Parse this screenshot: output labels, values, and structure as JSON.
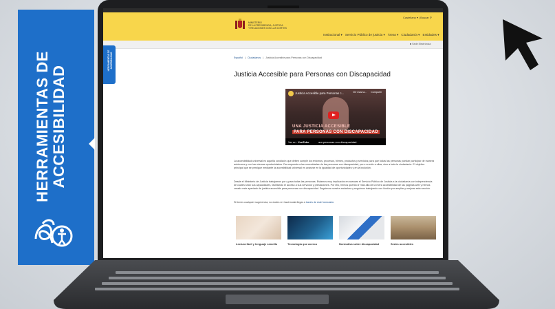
{
  "banner": {
    "line1": "HERRAMIENTAS DE",
    "line2": "ACCESIBILIDAD"
  },
  "site": {
    "gov_name": "MINISTERIO\nDE LA PRESIDENCIA, JUSTICIA\nY RELACIONES CON LAS CORTES",
    "util": "Castellano ▾  |  Buscar",
    "nav": [
      "Institucional ▾",
      "Servicio Público de justicia ▾",
      "Áreas ▾",
      "Ciudadanía ▾",
      "Entidades ▾"
    ],
    "sede": "Sede Electrónica",
    "side_tab": "HERRAMIENTAS DE ACCESIBILIDAD",
    "breadcrumb": [
      "Español",
      "Ciudadanos",
      "Justicia Accesible para Personas con Discapacidad"
    ],
    "title": "Justicia Accesible para Personas con Discapacidad",
    "video": {
      "title": "Justicia Accesible para Personas c...",
      "watch_later": "Ver más ta...",
      "share": "Compartir",
      "line1": "UNA JUSTICIA ACCESIBLE",
      "line2": "PARA PERSONAS CON DISCAPACIDAD",
      "watch_on": "Ver en",
      "youtube": "YouTube",
      "caption": "ara personas con discapacidad."
    },
    "para1": "La accesibilidad universal es aquella condición que deben cumplir los entornos, procesos, bienes, productos y servicios para que todas las personas puedan participar de manera autónoma y con las mismas oportunidades. Da respuesta a las necesidades de las personas con discapacidad, pero no sólo a ellas, sino a toda la ciudadanía. El objetivo principal que se persigue mediante la accesibilidad universal es avanzar en la igualdad de oportunidades y en la inclusión.",
    "para2": "Desde el Ministerio de Justicia trabajamos por y para todas las personas. Estamos muy implicados en avanzar el Servicio Público de Justicia a la ciudadanía con independencia de cuáles sean sus capacidades, facilitando el acceso a sus servicios y prestaciones. Por ello, hemos querido ir más allá de la mera accesibilidad de las páginas web y hemos creado este apartado de justicia accesible para personas con discapacidad. Seguimos nuestra andadura y seguimos trabajando con ilusión por ampliar y mejorar esta sección.",
    "para3_prefix": "Si tienes cualquier sugerencia, no dudes en hacérnosla llegar a ",
    "para3_link": "través de este formulario",
    "cards": [
      {
        "title": "Lectura fácil y lenguaje sencillo"
      },
      {
        "title": "Tecnología que acerca"
      },
      {
        "title": "Normativa sobre discapacidad"
      },
      {
        "title": "Sedes accesibles"
      }
    ]
  },
  "colors": {
    "banner_blue": "#1e6fc9",
    "header_yellow": "#f8d64b"
  }
}
